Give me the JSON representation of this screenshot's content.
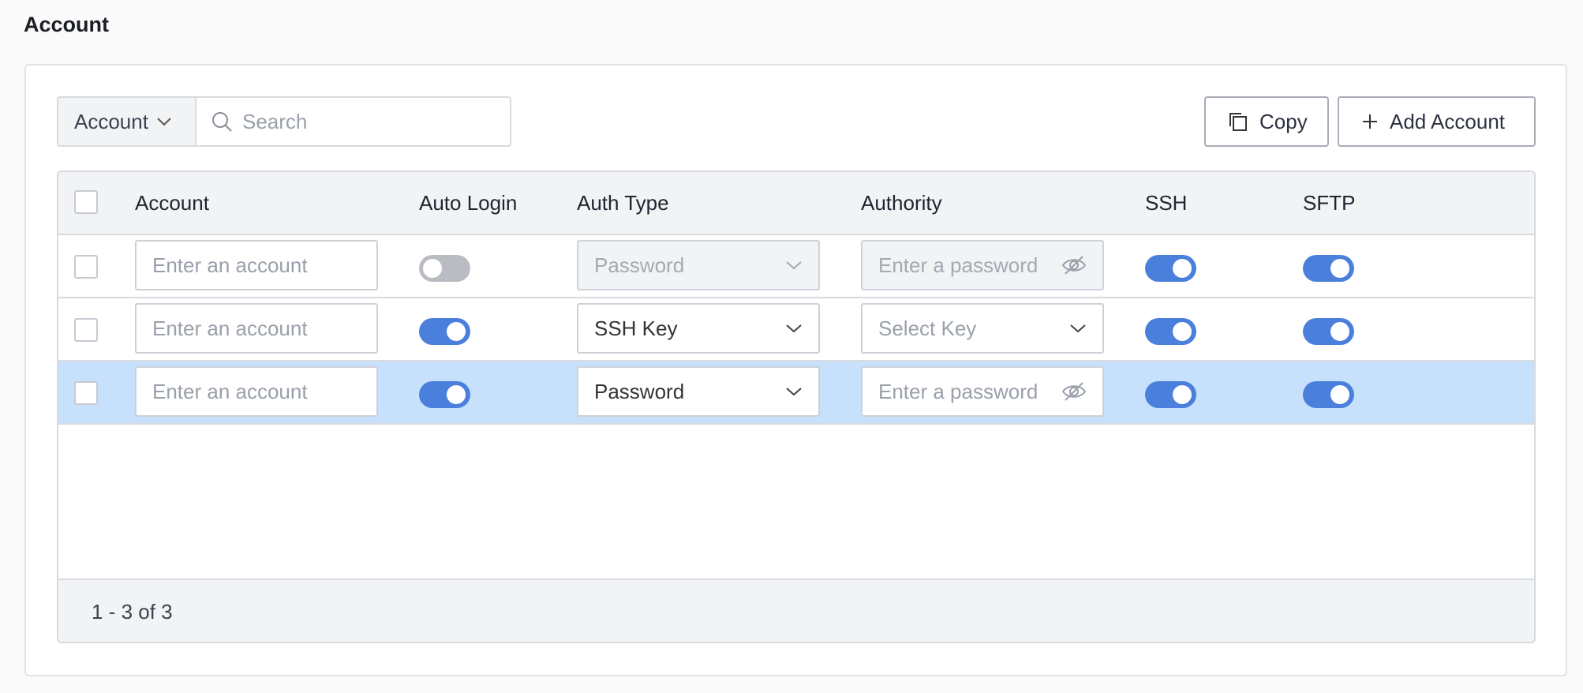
{
  "page": {
    "title": "Account"
  },
  "toolbar": {
    "filter_field": "Account",
    "search_placeholder": "Search",
    "copy_label": "Copy",
    "add_label": "Add Account"
  },
  "table": {
    "headers": {
      "account": "Account",
      "auto_login": "Auto Login",
      "auth_type": "Auth Type",
      "authority": "Authority",
      "ssh": "SSH",
      "sftp": "SFTP"
    },
    "rows": [
      {
        "account_placeholder": "Enter an account",
        "auto_login": false,
        "auth_type": "Password",
        "auth_type_disabled": true,
        "authority_placeholder": "Enter a password",
        "ssh": true,
        "sftp": true,
        "selected": false
      },
      {
        "account_placeholder": "Enter an account",
        "auto_login": true,
        "auth_type": "SSH Key",
        "auth_type_disabled": false,
        "authority_placeholder": "Select Key",
        "ssh": true,
        "sftp": true,
        "selected": false
      },
      {
        "account_placeholder": "Enter an account",
        "auto_login": true,
        "auth_type": "Password",
        "auth_type_disabled": false,
        "authority_placeholder": "Enter a password",
        "ssh": true,
        "sftp": true,
        "selected": true
      }
    ],
    "pagination": "1 - 3 of 3"
  },
  "colors": {
    "toggle_on": "#4a7fdc",
    "toggle_off": "#b9bdc3",
    "selected_row": "#c7e0fb"
  }
}
